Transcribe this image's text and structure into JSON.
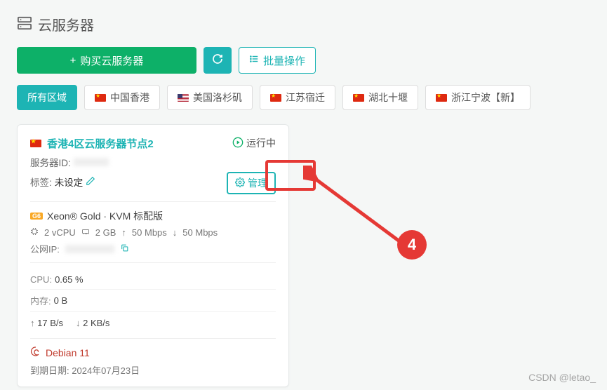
{
  "header": {
    "title": "云服务器"
  },
  "actions": {
    "buy_label": "购买云服务器",
    "batch_label": "批量操作"
  },
  "regions": {
    "all_label": "所有区域",
    "items": [
      {
        "label": "中国香港"
      },
      {
        "label": "美国洛杉矶"
      },
      {
        "label": "江苏宿迁"
      },
      {
        "label": "湖北十堰"
      },
      {
        "label": "浙江宁波【新】"
      }
    ]
  },
  "server": {
    "title": "香港4区云服务器节点2",
    "status_label": "运行中",
    "id_prefix": "服务器ID:",
    "tag_prefix": "标签:",
    "tag_value": "未设定",
    "manage_label": "管理",
    "spec_badge": "G6",
    "spec_title": "Xeon® Gold · KVM 标配版",
    "vcpu": "2 vCPU",
    "ram": "2 GB",
    "up": "50 Mbps",
    "down": "50 Mbps",
    "ip_prefix": "公网IP:",
    "cpu_label": "CPU:",
    "cpu_value": "0.65 %",
    "mem_label": "内存:",
    "mem_value": "0 B",
    "net_up": "17 B/s",
    "net_down": "2 KB/s",
    "os": "Debian 11",
    "expire_prefix": "到期日期:",
    "expire_value": "2024年07月23日"
  },
  "annotation": {
    "number": "4"
  },
  "watermark": "CSDN @letao_"
}
